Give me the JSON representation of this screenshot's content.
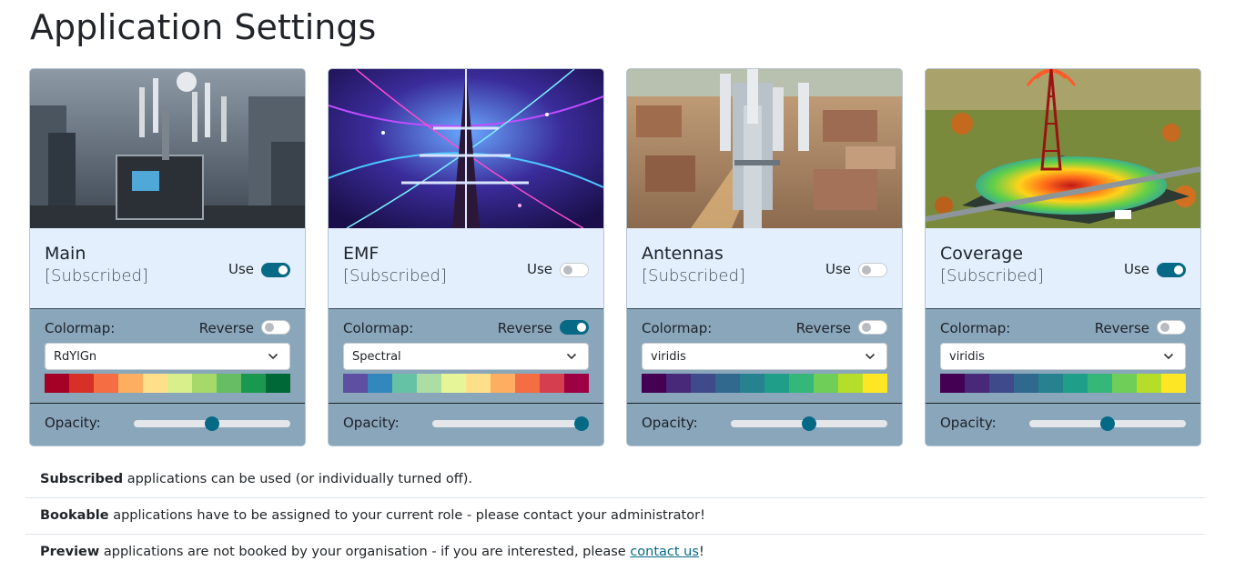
{
  "page": {
    "title": "Application Settings"
  },
  "labels": {
    "use": "Use",
    "colormap": "Colormap:",
    "reverse": "Reverse",
    "opacity": "Opacity:"
  },
  "apps": [
    {
      "name": "Main",
      "status": "[Subscribed]",
      "use": true,
      "colormap": "RdYlGn",
      "reverse": false,
      "opacity": 50,
      "swatches": [
        "#a50026",
        "#d73027",
        "#f46d43",
        "#fdae61",
        "#fee08b",
        "#d9ef8b",
        "#a6d96a",
        "#66bd63",
        "#1a9850",
        "#006837"
      ]
    },
    {
      "name": "EMF",
      "status": "[Subscribed]",
      "use": false,
      "colormap": "Spectral",
      "reverse": true,
      "opacity": 100,
      "swatches": [
        "#5e4fa2",
        "#3288bd",
        "#66c2a5",
        "#abdda4",
        "#e6f598",
        "#fee08b",
        "#fdae61",
        "#f46d43",
        "#d53e4f",
        "#9e0142"
      ]
    },
    {
      "name": "Antennas",
      "status": "[Subscribed]",
      "use": false,
      "colormap": "viridis",
      "reverse": false,
      "opacity": 50,
      "swatches": [
        "#440154",
        "#482878",
        "#3e4a89",
        "#31688e",
        "#26828e",
        "#1f9e89",
        "#35b779",
        "#6ece58",
        "#b5de2b",
        "#fde725"
      ]
    },
    {
      "name": "Coverage",
      "status": "[Subscribed]",
      "use": true,
      "colormap": "viridis",
      "reverse": false,
      "opacity": 50,
      "swatches": [
        "#440154",
        "#482878",
        "#3e4a89",
        "#31688e",
        "#26828e",
        "#1f9e89",
        "#35b779",
        "#6ece58",
        "#b5de2b",
        "#fde725"
      ]
    }
  ],
  "info": {
    "subscribed_term": "Subscribed",
    "subscribed_text": " applications can be used (or individually turned off).",
    "bookable_term": "Bookable",
    "bookable_text": " applications have to be assigned to your current role - please contact your administrator!",
    "preview_term": "Preview",
    "preview_text": " applications are not booked by your organisation - if you are interested, please ",
    "preview_link": "contact us",
    "preview_end": "!"
  },
  "colors": {
    "accent": "#066a87",
    "card_header": "#e3effd",
    "card_body": "#8aa6ba"
  }
}
